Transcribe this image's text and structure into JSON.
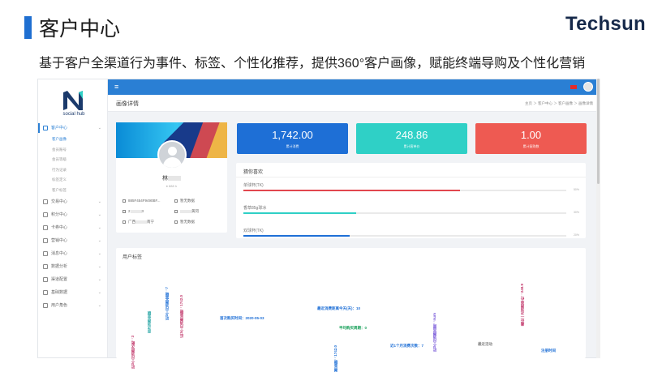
{
  "slide": {
    "title": "客户中心",
    "brand": "Techsun",
    "subtitle": "基于客户全渠道行为事件、标签、个性化推荐，提供360°客户画像，赋能终端导购及个性化营销"
  },
  "app": {
    "logo_text": "social hub",
    "menu_icon": "menu-icon",
    "sidebar": {
      "items": [
        {
          "label": "客户中心",
          "icon": "monitor-icon",
          "active": true,
          "chevron": "⌄",
          "children": [
            {
              "label": "客户画像",
              "active": true
            },
            {
              "label": "会员账号",
              "active": false
            },
            {
              "label": "会员等级",
              "active": false
            },
            {
              "label": "行为记录",
              "active": false
            },
            {
              "label": "标签定义",
              "active": false
            },
            {
              "label": "客户标签",
              "active": false
            }
          ]
        },
        {
          "label": "交易中心",
          "icon": "trade-icon",
          "chevron": "⌄"
        },
        {
          "label": "积分中心",
          "icon": "points-icon",
          "chevron": "⌄"
        },
        {
          "label": "卡券中心",
          "icon": "coupon-icon",
          "chevron": "⌄"
        },
        {
          "label": "营销中心",
          "icon": "marketing-icon",
          "chevron": "⌄"
        },
        {
          "label": "消息中心",
          "icon": "message-icon",
          "chevron": "⌄"
        },
        {
          "label": "数据分析",
          "icon": "analytics-icon",
          "chevron": "⌄"
        },
        {
          "label": "渠道配置",
          "icon": "channel-icon",
          "chevron": "⌄"
        },
        {
          "label": "基础数据",
          "icon": "data-icon",
          "chevron": "⌄"
        },
        {
          "label": "用户角色",
          "icon": "role-icon",
          "chevron": "⌄"
        }
      ]
    },
    "page_title": "画像详情",
    "breadcrumb": "主页 ＞ 客户中心 ＞ 客户画像 ＞ 画像详情",
    "profile": {
      "name": "林",
      "sub": "♦ 888 h",
      "info": [
        {
          "icon": "id-icon",
          "text": "885F454F9490BF..."
        },
        {
          "icon": "mail-icon",
          "text": "暂无数据"
        },
        {
          "icon": "phone-icon",
          "text": "3"
        },
        {
          "icon": "location-icon",
          "text": "黄冈"
        },
        {
          "icon": "home-icon",
          "text": "广西"
        },
        {
          "icon": "address-icon",
          "text": "南宁"
        },
        {
          "icon": "star-icon",
          "text": "暂无数据"
        }
      ]
    },
    "stats": [
      {
        "value": "1,742.00",
        "label": "累计消费",
        "color": "#1e6fd6"
      },
      {
        "value": "248.86",
        "label": "累计客单价",
        "color": "#2fd0c6"
      },
      {
        "value": "1.00",
        "label": "累计复购数",
        "color": "#ee5a52"
      }
    ],
    "guess": {
      "title": "猜你喜欢",
      "items": [
        {
          "label": "单球杯(TK)",
          "pct": "50%",
          "fill": 0.67,
          "color": "#e2474e"
        },
        {
          "label": "香草85g球冰",
          "pct": "30%",
          "fill": 0.35,
          "color": "#2fd0c6"
        },
        {
          "label": "双球杯(TK)",
          "pct": "20%",
          "fill": 0.33,
          "color": "#1e6fd6"
        }
      ]
    },
    "tags": {
      "title": "用户标签",
      "words": [
        {
          "text": "近3个月消费次数：3",
          "color": "#c2386b",
          "vertical": true
        },
        {
          "text": "首次消费金额",
          "color": "#2aa6a6",
          "vertical": true
        },
        {
          "text": "近3个月消费金额：7",
          "color": "#1e6fd6",
          "vertical": true
        },
        {
          "text": "近3个月消费金额：1742.0",
          "color": "#c2386b",
          "vertical": true
        },
        {
          "text": "首次购买时间：2020-05-03",
          "color": "#1e6fd6",
          "vertical": false
        },
        {
          "text": "最近消费距离今天(天)：10",
          "color": "#1e6fd6",
          "vertical": false
        },
        {
          "text": "平均购买周期：0",
          "color": "#18a05a",
          "vertical": false
        },
        {
          "text": "近3个月消费金额：1742.0",
          "color": "#1e6fd6",
          "vertical": true
        },
        {
          "text": "近1个月消费次数：7",
          "color": "#1e6fd6",
          "vertical": false
        },
        {
          "text": "近3个月消费品类：num",
          "color": "#6d4bd6",
          "vertical": true
        },
        {
          "text": "最近活动",
          "color": "#888888",
          "vertical": false
        },
        {
          "text": "最近一次消费单价：248.9",
          "color": "#c2386b",
          "vertical": true
        },
        {
          "text": "注册时间",
          "color": "#1e6fd6",
          "vertical": false
        }
      ]
    }
  }
}
